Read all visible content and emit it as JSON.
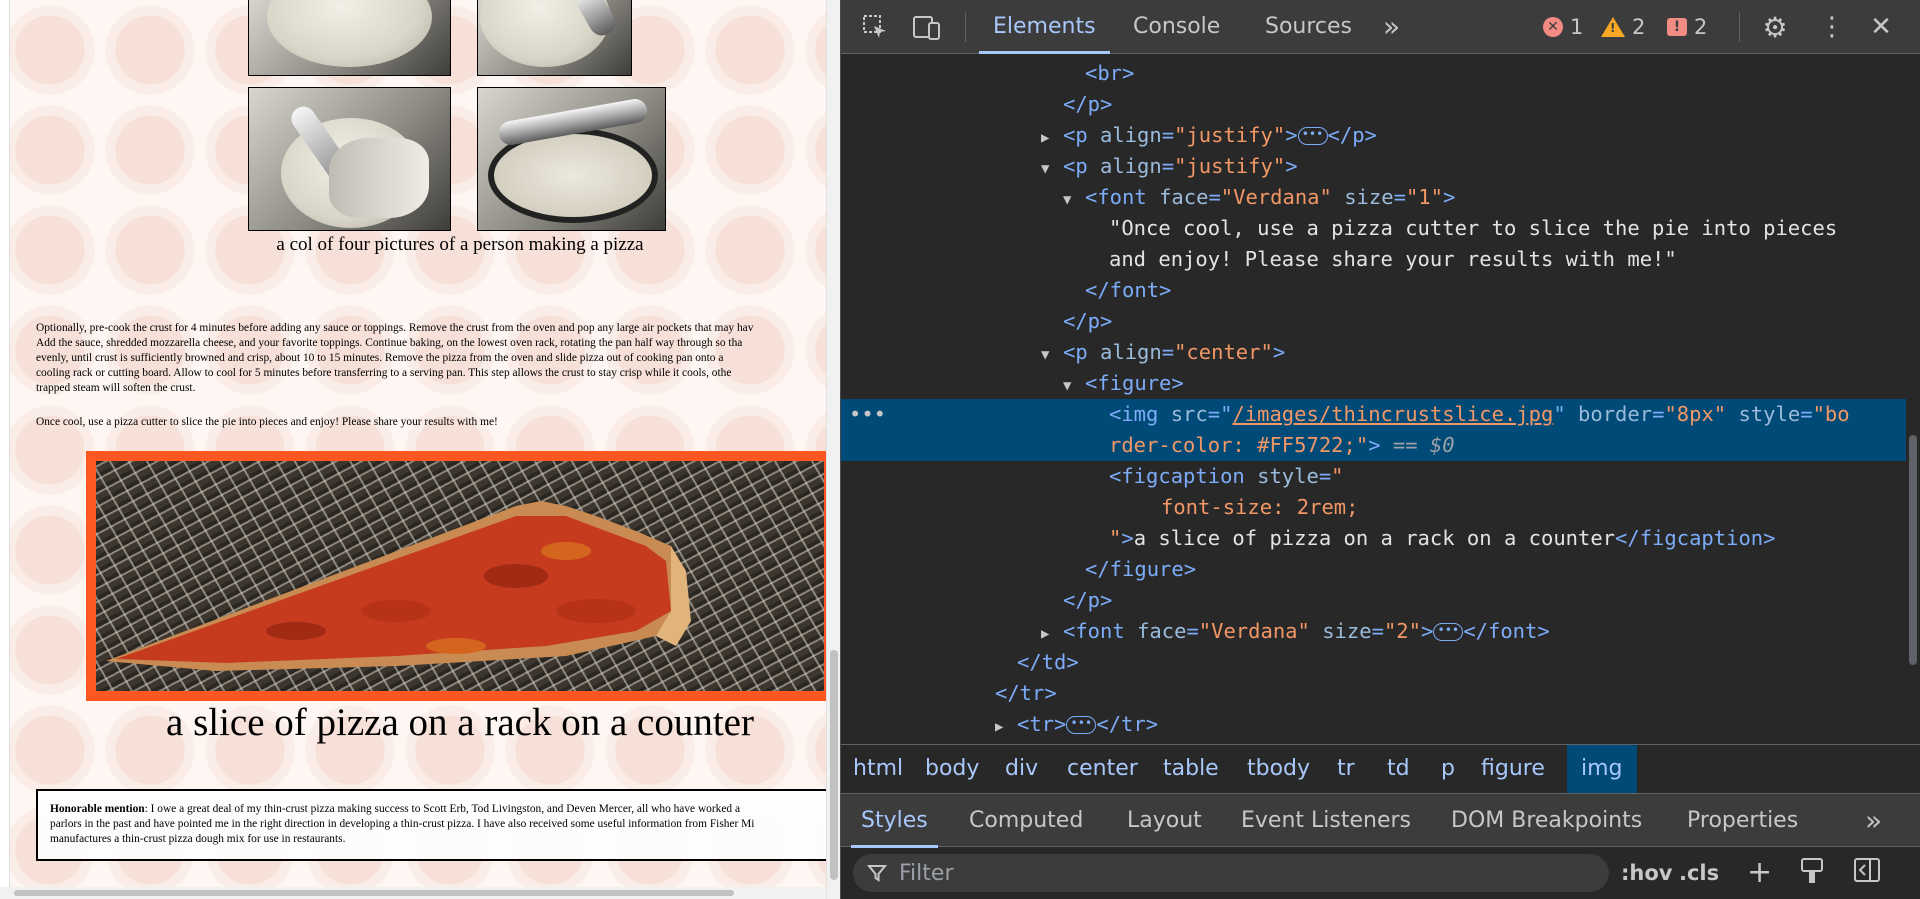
{
  "page": {
    "caption_four": "a col of four pictures of a person making a pizza",
    "paragraph_lines": [
      "Optionally, pre-cook the crust for 4 minutes before adding any sauce or toppings. Remove the crust from the oven and pop any large air pockets that may hav",
      "Add the sauce, shredded mozzarella cheese, and your favorite toppings. Continue baking, on the lowest oven rack, rotating the pan half way through so tha",
      "evenly, until crust is sufficiently browned and crisp, about 10 to 15 minutes. Remove the pizza from the oven and slide pizza out of cooking pan onto a",
      "cooling rack or cutting board. Allow to cool for 5 minutes before transferring to a serving pan. This step allows the crust to stay crisp while it cools, othe",
      "trapped steam will soften the crust."
    ],
    "once_cool": "Once cool, use a pizza cutter to slice the pie into pieces and enjoy! Please share your results with me!",
    "caption_slice": "a slice of pizza on a rack on a counter",
    "mention_bold": "Honorable mention",
    "mention_lines": [
      ": I owe a great deal of my thin-crust pizza making success to Scott Erb, Tod Livingston, and Deven Mercer, all who have worked a",
      "parlors in the past and have pointed me in the right direction in developing a thin-crust pizza. I have also received some useful information from Fisher Mi",
      "manufactures a thin-crust pizza dough mix for use in restaurants."
    ],
    "img_border_color": "#FF5722"
  },
  "devtools": {
    "tabs": [
      "Elements",
      "Console",
      "Sources"
    ],
    "more_tabs": "»",
    "errors": "1",
    "warnings": "2",
    "issues": "2",
    "dom": {
      "l1": "<br>",
      "l2": "</p>",
      "l3_attr": "align",
      "l3_val": "\"justify\"",
      "l4_attr": "align",
      "l4_val": "\"justify\"",
      "l5_face_attr": "face",
      "l5_face_val": "\"Verdana\"",
      "l5_size_attr": "size",
      "l5_size_val": "\"1\"",
      "l6": "\"Once cool, use a pizza cutter to slice the pie into pieces",
      "l7": "and enjoy! Please share your results with me!\"",
      "l8": "</font>",
      "l9": "</p>",
      "l10_attr": "align",
      "l10_val": "\"center\"",
      "l11": "<figure>",
      "l12_src_attr": "src",
      "l12_src_val": "/images/thincrustslice.jpg",
      "l12_border_attr": "border",
      "l12_border_val": "\"8px\"",
      "l12_style_attr": "style",
      "l12_style_val_a": "\"bo",
      "l13_style_val_b": "rder-color: #FF5722;\"",
      "l13_eq": "== $0",
      "l14_attr": "style",
      "l14_val": "\"",
      "l15": "font-size: 2rem;",
      "l16_val_end": "\"",
      "l16_text": "a slice of pizza on a rack on a counter",
      "l17": "</figure>",
      "l18": "</p>",
      "l19_face_attr": "face",
      "l19_face_val": "\"Verdana\"",
      "l19_size_attr": "size",
      "l19_size_val": "\"2\"",
      "l20": "</td>",
      "l21": "</tr>",
      "l22": "<tr>"
    },
    "breadcrumbs": [
      "html",
      "body",
      "div",
      "center",
      "table",
      "tbody",
      "tr",
      "td",
      "p",
      "figure",
      "img"
    ],
    "sub_tabs": [
      "Styles",
      "Computed",
      "Layout",
      "Event Listeners",
      "DOM Breakpoints",
      "Properties"
    ],
    "filter_placeholder": "Filter",
    "hov": ":hov",
    "cls": ".cls"
  }
}
